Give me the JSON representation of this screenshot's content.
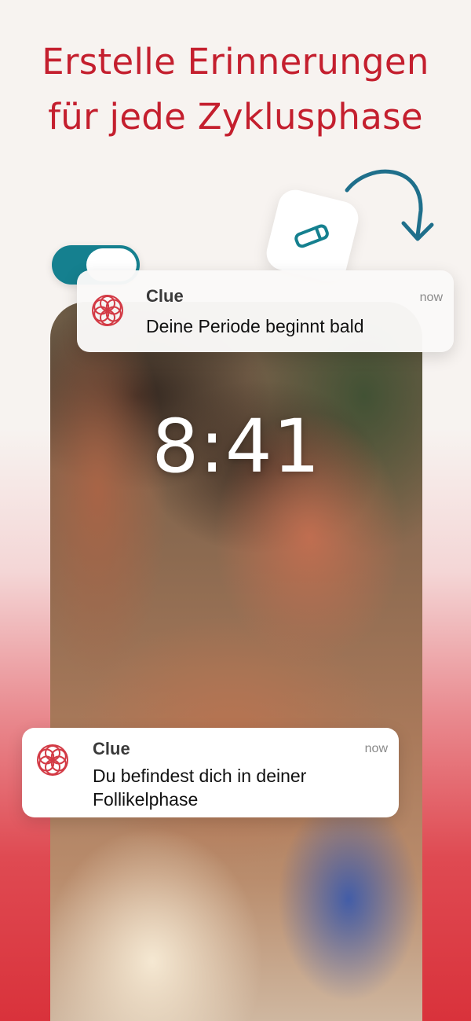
{
  "headline": {
    "line1": "Erstelle Erinnerungen",
    "line2": "für jede Zyklusphase"
  },
  "colors": {
    "brand_red": "#c41f2e",
    "toggle_teal": "#15808f",
    "arrow_teal": "#1f6f8b"
  },
  "icons": {
    "edit": "pencil-icon",
    "arrow": "curved-arrow-icon",
    "app": "clue-flower-logo"
  },
  "toggle": {
    "state": "on"
  },
  "lockscreen": {
    "time": "8:41"
  },
  "notifications": [
    {
      "app": "Clue",
      "time": "now",
      "message": "Deine Periode beginnt bald"
    },
    {
      "app": "Clue",
      "time": "now",
      "message": "Du befindest dich in deiner Follikelphase"
    }
  ]
}
